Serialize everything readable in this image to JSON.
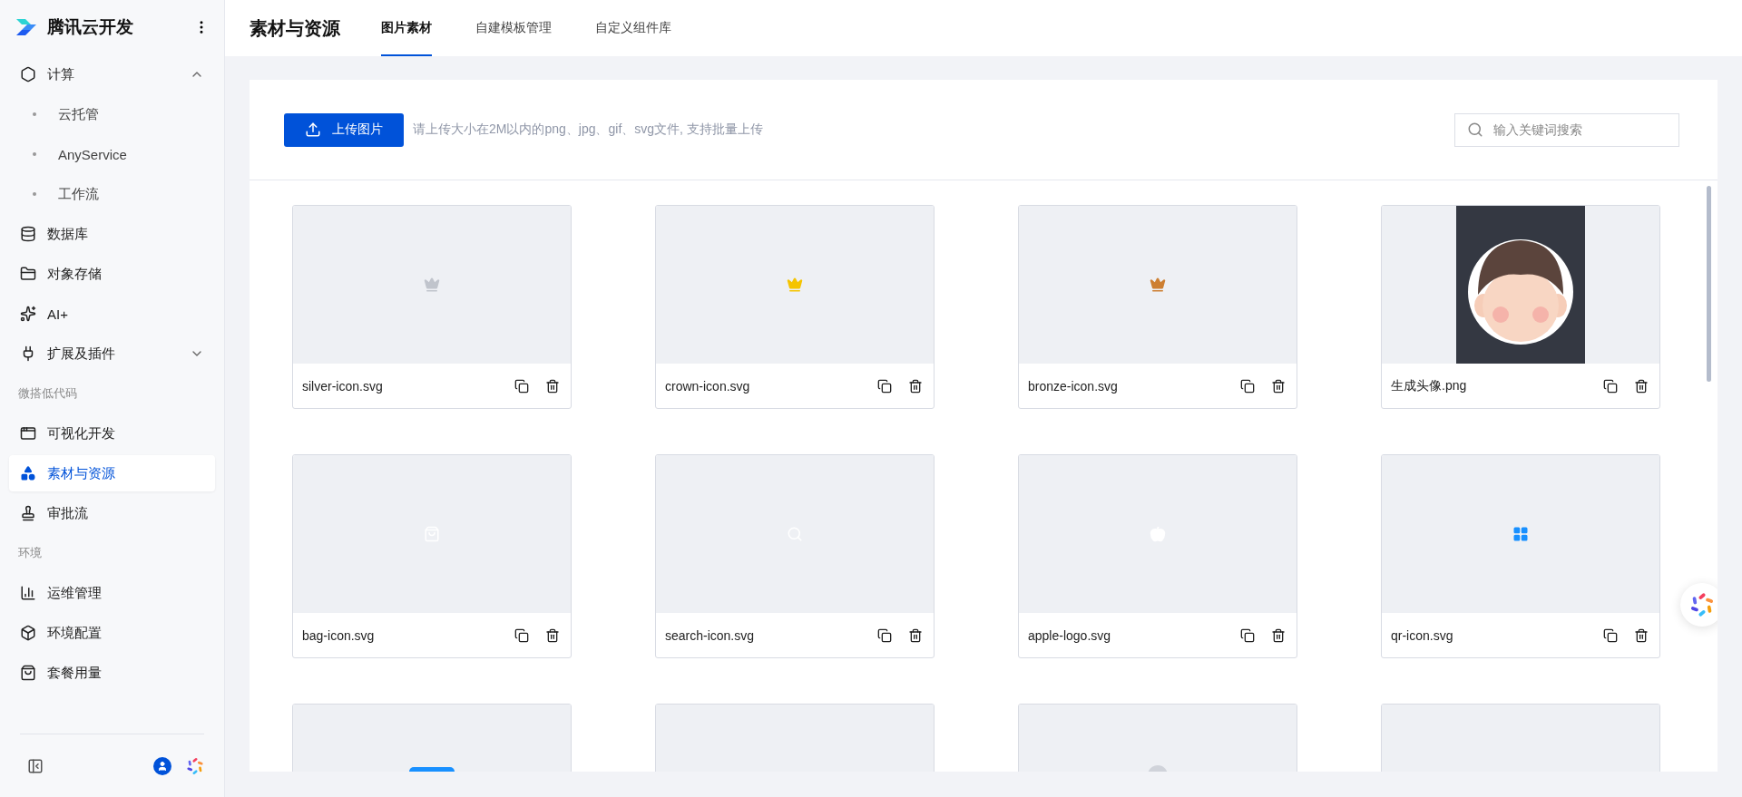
{
  "brand": {
    "title": "腾讯云开发"
  },
  "sidebar": {
    "sections": [
      {
        "items": [
          {
            "label": "计算",
            "selected": false,
            "expanded": true,
            "children": [
              {
                "label": "云托管",
                "selected": false
              },
              {
                "label": "AnyService",
                "selected": false
              },
              {
                "label": "工作流",
                "selected": false
              }
            ]
          },
          {
            "label": "数据库",
            "selected": false
          },
          {
            "label": "对象存储",
            "selected": false
          },
          {
            "label": "AI+",
            "selected": false
          },
          {
            "label": "扩展及插件",
            "selected": false,
            "expanded": false
          }
        ]
      },
      {
        "heading": "微搭低代码",
        "items": [
          {
            "label": "可视化开发",
            "selected": false
          },
          {
            "label": "素材与资源",
            "selected": true
          },
          {
            "label": "审批流",
            "selected": false
          }
        ]
      },
      {
        "heading": "环境",
        "items": [
          {
            "label": "运维管理",
            "selected": false
          },
          {
            "label": "环境配置",
            "selected": false
          },
          {
            "label": "套餐用量",
            "selected": false
          }
        ]
      }
    ]
  },
  "page": {
    "title": "素材与资源",
    "tabs": [
      {
        "label": "图片素材",
        "selected": true
      },
      {
        "label": "自建模板管理",
        "selected": false
      },
      {
        "label": "自定义组件库",
        "selected": false
      }
    ]
  },
  "toolbar": {
    "upload_button": "上传图片",
    "hint": "请上传大小在2M以内的png、jpg、gif、svg文件, 支持批量上传",
    "search": {
      "placeholder": "输入关键词搜索"
    }
  },
  "assets": [
    {
      "name": "silver-icon.svg",
      "kind": "crown",
      "color": "#c0c4cc"
    },
    {
      "name": "crown-icon.svg",
      "kind": "crown",
      "color": "#f5c400"
    },
    {
      "name": "bronze-icon.svg",
      "kind": "crown",
      "color": "#cd7f32"
    },
    {
      "name": "生成头像.png",
      "kind": "picture"
    },
    {
      "name": "bag-icon.svg",
      "kind": "bag",
      "color": "#ffffff"
    },
    {
      "name": "search-icon.svg",
      "kind": "search",
      "color": "#ffffff"
    },
    {
      "name": "apple-logo.svg",
      "kind": "apple",
      "color": "#ffffff"
    },
    {
      "name": "qr-icon.svg",
      "kind": "grid",
      "color": "#1890ff"
    },
    {
      "kind": "block",
      "color": "#1890ff"
    },
    {
      "kind": "empty"
    },
    {
      "kind": "dot",
      "color": "#d0d3da"
    },
    {
      "kind": "empty"
    }
  ]
}
